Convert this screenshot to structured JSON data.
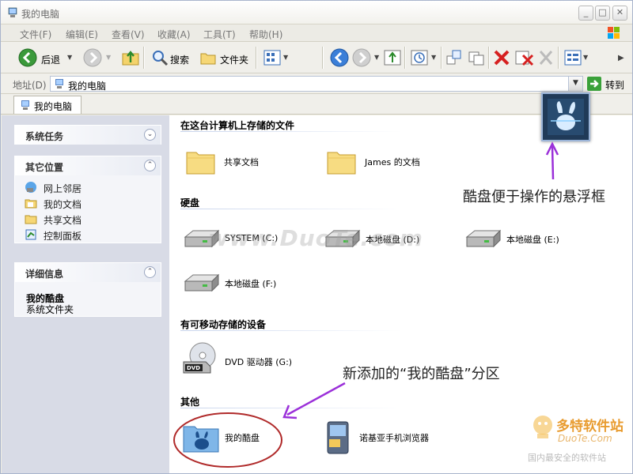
{
  "window": {
    "title": "我的电脑"
  },
  "menu": [
    "文件(F)",
    "编辑(E)",
    "查看(V)",
    "收藏(A)",
    "工具(T)",
    "帮助(H)"
  ],
  "toolbar": {
    "back_label": "后退",
    "search_label": "搜索",
    "folders_label": "文件夹"
  },
  "address": {
    "label": "地址(D)",
    "value": "我的电脑",
    "go_label": "转到"
  },
  "tab": {
    "label": "我的电脑"
  },
  "left": {
    "tasks_title": "系统任务",
    "places_title": "其它位置",
    "places": [
      "网上邻居",
      "我的文档",
      "共享文档",
      "控制面板"
    ],
    "details_title": "详细信息",
    "details_name": "我的酷盘",
    "details_type": "系统文件夹"
  },
  "groups": {
    "stored": {
      "title": "在这台计算机上存储的文件",
      "items": [
        "共享文档",
        "James 的文档"
      ]
    },
    "disks": {
      "title": "硬盘",
      "items": [
        "SYSTEM (C:)",
        "本地磁盘 (D:)",
        "本地磁盘 (E:)",
        "本地磁盘 (F:)"
      ]
    },
    "removable": {
      "title": "有可移动存储的设备",
      "items": [
        "DVD 驱动器 (G:)"
      ]
    },
    "other": {
      "title": "其他",
      "items": [
        "我的酷盘",
        "诺基亚手机浏览器"
      ]
    }
  },
  "annotations": {
    "float": "酷盘便于操作的悬浮框",
    "added": "新添加的“我的酷盘”分区",
    "watermark": "www.DuoTe.com"
  },
  "logo": {
    "main": "多特软件站",
    "url": "DuoTe.Com",
    "sub": "国内最安全的软件站"
  },
  "colors": {
    "annotation_arrow": "#9b30d9",
    "highlight_ring": "#b02a2a"
  }
}
